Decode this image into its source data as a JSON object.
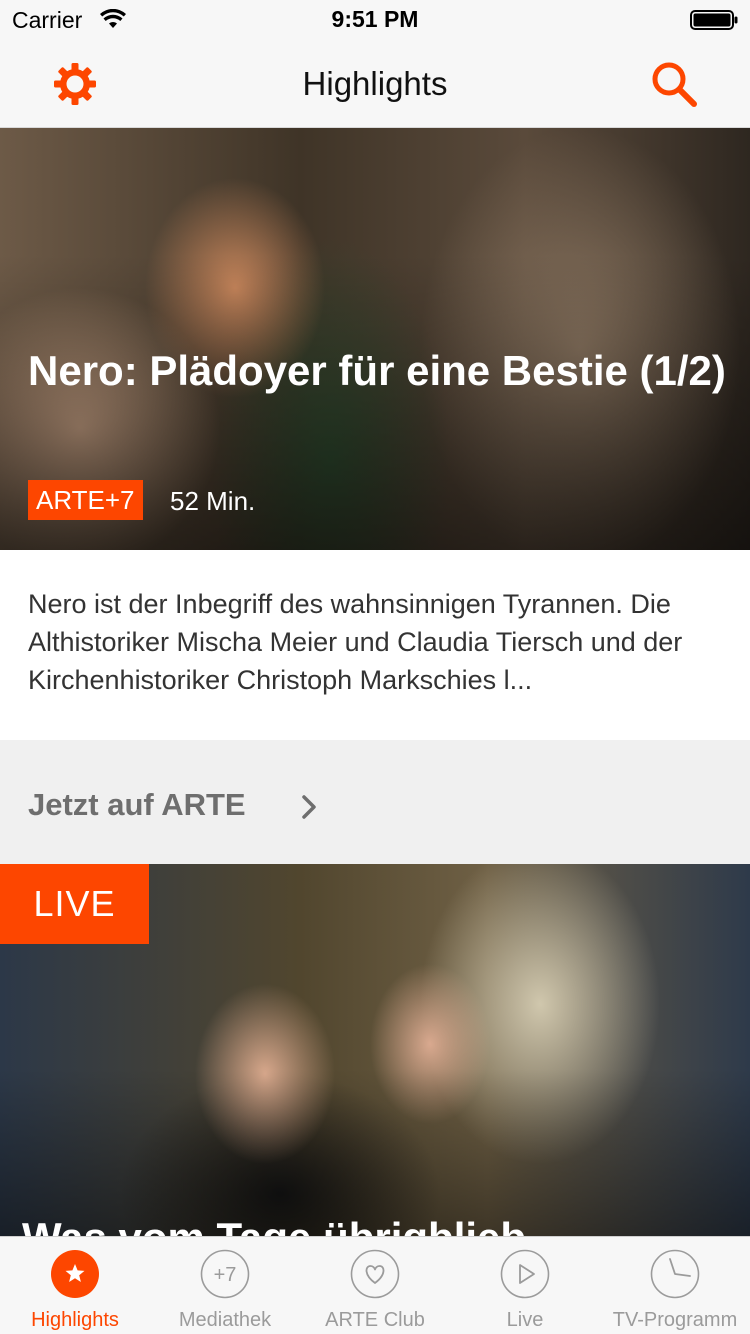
{
  "status_bar": {
    "carrier": "Carrier",
    "time": "9:51 PM"
  },
  "nav": {
    "title": "Highlights",
    "settings_icon": "gear-icon",
    "search_icon": "search-icon"
  },
  "hero": {
    "title": "Nero: Plädoyer für eine Bestie (1/2)",
    "badge": "ARTE+7",
    "duration": "52 Min.",
    "description": "Nero ist der Inbegriff des wahnsinnigen Tyrannen. Die Althistoriker Mischa Meier und Claudia Tiersch und der Kirchenhistoriker Christoph Markschies l..."
  },
  "section": {
    "title": "Jetzt auf ARTE"
  },
  "live": {
    "badge": "LIVE",
    "title": "Was vom Tage übrigblieb"
  },
  "tabs": [
    {
      "label": "Highlights",
      "icon": "star-icon",
      "active": true
    },
    {
      "label": "Mediathek",
      "icon": "plus-seven-icon",
      "icon_text": "+7",
      "active": false
    },
    {
      "label": "ARTE Club",
      "icon": "heart-icon",
      "active": false
    },
    {
      "label": "Live",
      "icon": "play-icon",
      "active": false
    },
    {
      "label": "TV-Programm",
      "icon": "clock-icon",
      "active": false
    }
  ],
  "colors": {
    "accent": "#fd4600",
    "tab_inactive": "#9b9b9b",
    "section_text": "#6e6e6e"
  }
}
